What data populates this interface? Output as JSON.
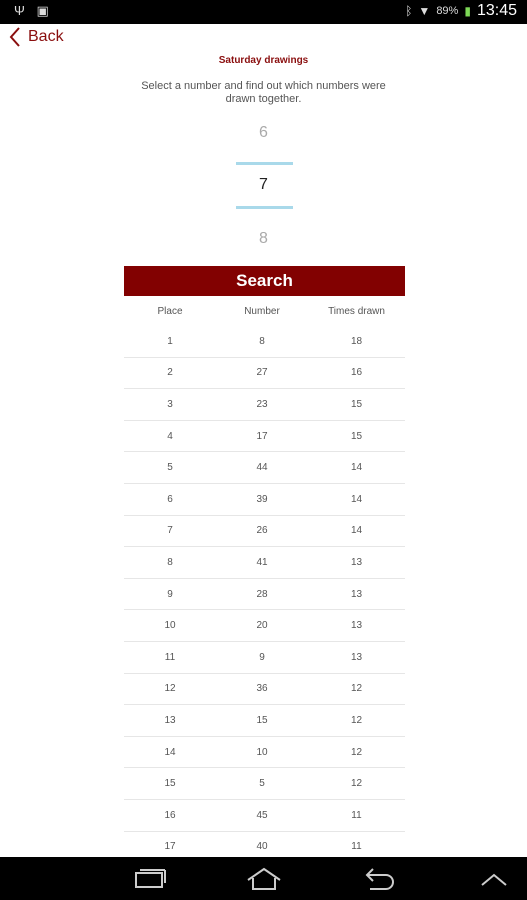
{
  "status_bar": {
    "battery_percent": "89%",
    "time": "13:45",
    "icons": [
      "usb-icon",
      "image-icon",
      "bluetooth-icon",
      "wifi-icon",
      "battery-icon"
    ]
  },
  "back": {
    "label": "Back"
  },
  "title": "Saturday drawings",
  "subtitle": "Select a number and find out which numbers were drawn together.",
  "picker": {
    "previous": "6",
    "selected": "7",
    "next": "8"
  },
  "search": {
    "label": "Search"
  },
  "table": {
    "headers": [
      "Place",
      "Number",
      "Times drawn"
    ],
    "rows": [
      [
        "1",
        "8",
        "18"
      ],
      [
        "2",
        "27",
        "16"
      ],
      [
        "3",
        "23",
        "15"
      ],
      [
        "4",
        "17",
        "15"
      ],
      [
        "5",
        "44",
        "14"
      ],
      [
        "6",
        "39",
        "14"
      ],
      [
        "7",
        "26",
        "14"
      ],
      [
        "8",
        "41",
        "13"
      ],
      [
        "9",
        "28",
        "13"
      ],
      [
        "10",
        "20",
        "13"
      ],
      [
        "11",
        "9",
        "13"
      ],
      [
        "12",
        "36",
        "12"
      ],
      [
        "13",
        "15",
        "12"
      ],
      [
        "14",
        "10",
        "12"
      ],
      [
        "15",
        "5",
        "12"
      ],
      [
        "16",
        "45",
        "11"
      ],
      [
        "17",
        "40",
        "11"
      ]
    ]
  },
  "colors": {
    "accent": "#820101",
    "picker_line": "#a9d9ea"
  }
}
